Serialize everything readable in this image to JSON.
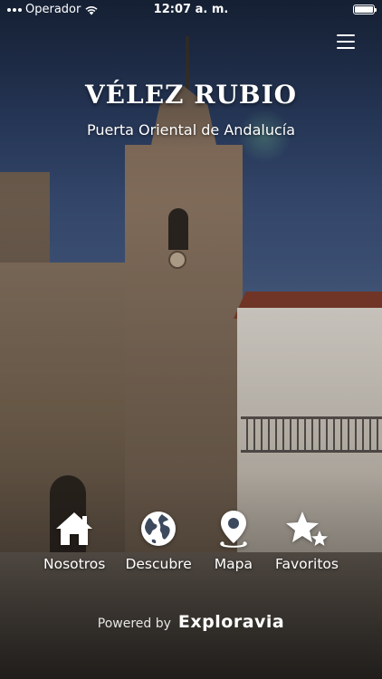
{
  "status_bar": {
    "carrier": "Operador",
    "time": "12:07 a. m."
  },
  "header": {
    "title": "VÉLEZ RUBIO",
    "subtitle": "Puerta Oriental de Andalucía"
  },
  "nav": {
    "items": [
      {
        "label": "Nosotros",
        "icon": "home-icon"
      },
      {
        "label": "Descubre",
        "icon": "globe-icon"
      },
      {
        "label": "Mapa",
        "icon": "map-pin-icon"
      },
      {
        "label": "Favoritos",
        "icon": "stars-icon"
      }
    ]
  },
  "footer": {
    "powered_by": "Powered by",
    "brand": "Exploravia"
  }
}
